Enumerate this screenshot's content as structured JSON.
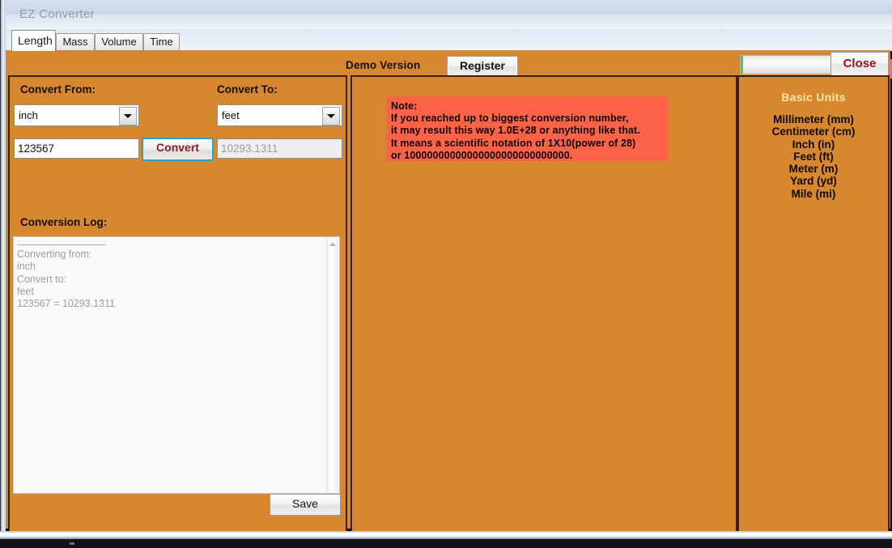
{
  "window": {
    "title": "EZ Converter"
  },
  "tabs": [
    {
      "label": "Length",
      "active": true
    },
    {
      "label": "Mass",
      "active": false
    },
    {
      "label": "Volume",
      "active": false
    },
    {
      "label": "Time",
      "active": false
    }
  ],
  "header": {
    "demo_label": "Demo Version",
    "register_label": "Register",
    "close_label": "Close",
    "progress_value": 0
  },
  "converter": {
    "convert_from_label": "Convert From:",
    "convert_to_label": "Convert To:",
    "from_unit": "inch",
    "to_unit": "feet",
    "input_value": "123567",
    "result_value": "10293.1311",
    "convert_button": "Convert",
    "log_label": "Conversion Log:",
    "log_text": "Converting from:\ninch\nConvert to:\nfeet\n123567 = 10293.1311",
    "save_button": "Save"
  },
  "note": {
    "line1": "Note:",
    "line2": "If you reached up to biggest conversion number,",
    "line3": "it may result this way 1.0E+28 or anything like that.",
    "line4": "It means a scientific notation of 1X10(power of 28)",
    "line5": "or 10000000000000000000000000000."
  },
  "basic_units": {
    "title": "Basic Units",
    "items": [
      "Millimeter (mm)",
      "Centimeter (cm)",
      "Inch (in)",
      "Feet (ft)",
      "Meter (m)",
      "Yard (yd)",
      "Mile (mi)"
    ]
  },
  "colors": {
    "panel_orange": "#d7872f",
    "pink_bar": "#fd63a8",
    "note_bg": "#ff6347",
    "accent_red": "#9b1118",
    "units_title": "#ffe9a8"
  }
}
